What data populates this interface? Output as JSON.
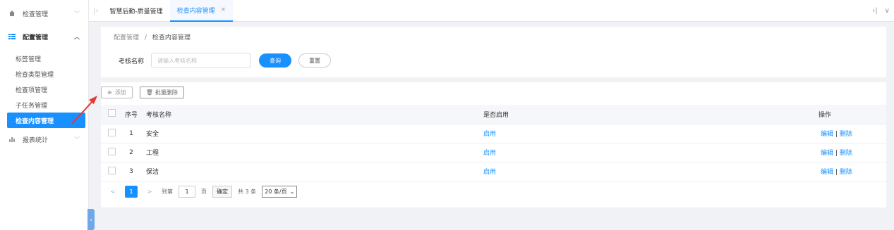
{
  "sidebar": {
    "top_item": {
      "label": "检查管理",
      "icon": "home-icon"
    },
    "section": {
      "label": "配置管理",
      "icon": "list-icon"
    },
    "items": [
      {
        "label": "标签管理"
      },
      {
        "label": "检查类型管理"
      },
      {
        "label": "检查项管理"
      },
      {
        "label": "子任务管理"
      },
      {
        "label": "检查内容管理",
        "active": true
      }
    ],
    "report": {
      "label": "报表统计",
      "icon": "bar-chart-icon"
    }
  },
  "tabs": [
    {
      "label": "智慧后勤-质量管理"
    },
    {
      "label": "检查内容管理",
      "active": true,
      "close": "×"
    }
  ],
  "tabs_controls": {
    "last": "›|",
    "menu": "∨",
    "first": "|‹"
  },
  "breadcrumb": {
    "root": "配置管理",
    "sep": "/",
    "current": "检查内容管理"
  },
  "filter": {
    "label": "考核名称",
    "placeholder": "请输入考核名称",
    "query_label": "查询",
    "reset_label": "重置"
  },
  "toolbar": {
    "add_label": "添加",
    "batch_delete_label": "批量删除"
  },
  "table": {
    "headers": {
      "index": "序号",
      "name": "考核名称",
      "enabled": "是否启用",
      "ops": "操作"
    },
    "rows": [
      {
        "index": "1",
        "name": "安全",
        "enabled": "启用",
        "edit": "编辑",
        "sep": "|",
        "delete": "删除"
      },
      {
        "index": "2",
        "name": "工程",
        "enabled": "启用",
        "edit": "编辑",
        "sep": "|",
        "delete": "删除"
      },
      {
        "index": "3",
        "name": "保洁",
        "enabled": "启用",
        "edit": "编辑",
        "sep": "|",
        "delete": "删除"
      }
    ]
  },
  "pagination": {
    "prev": "<",
    "current": "1",
    "next": ">",
    "goto_label": "到第",
    "goto_value": "1",
    "page_unit": "页",
    "confirm": "确定",
    "total": "共 3 条",
    "page_size": "20 条/页"
  },
  "colors": {
    "accent": "#1890ff",
    "annotation_arrow": "#e53935"
  }
}
